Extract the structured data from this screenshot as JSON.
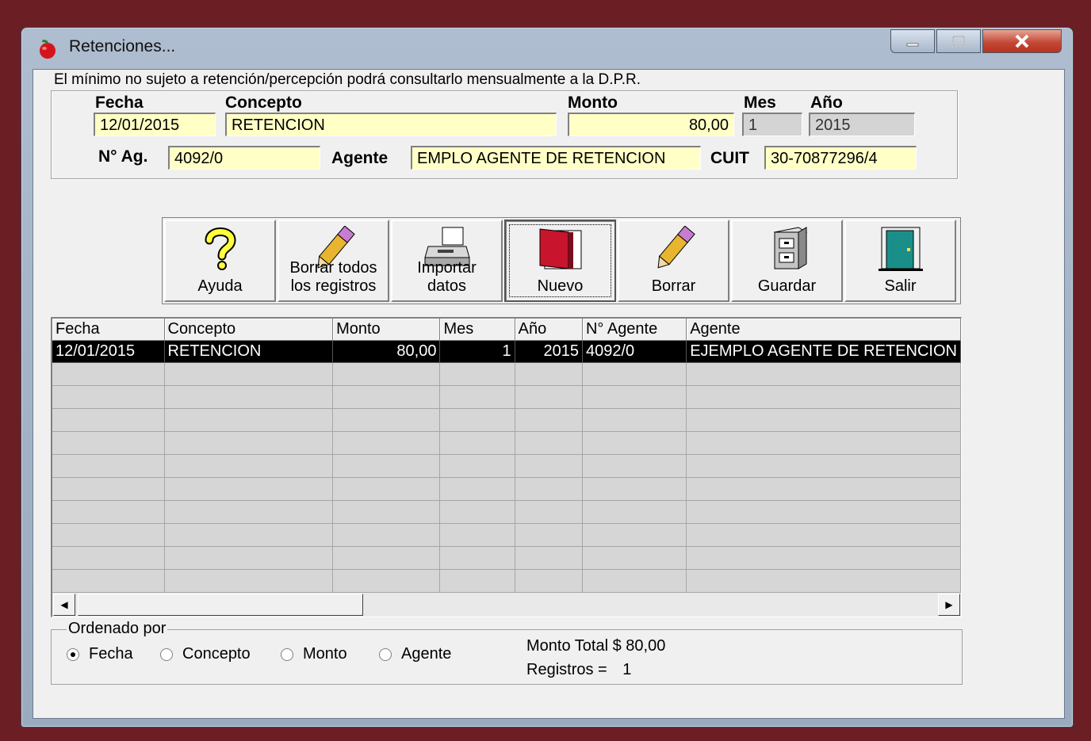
{
  "window": {
    "title": "Retenciones..."
  },
  "info_text": "El mínimo no sujeto a retención/percepción podrá consultarlo mensualmente a la D.P.R.",
  "form": {
    "fecha_label": "Fecha",
    "fecha_value": "12/01/2015",
    "concepto_label": "Concepto",
    "concepto_value": "RETENCION",
    "monto_label": "Monto",
    "monto_value": "80,00",
    "mes_label": "Mes",
    "mes_value": "1",
    "anio_label": "Año",
    "anio_value": "2015",
    "nag_label": "N° Ag.",
    "nag_value": "4092/0",
    "agente_label": "Agente",
    "agente_value": "EMPLO AGENTE DE RETENCION",
    "cuit_label": "CUIT",
    "cuit_value": "30-70877296/4"
  },
  "toolbar": [
    {
      "name": "help-button",
      "icon": "question-mark-icon",
      "line1": "",
      "line2": "Ayuda"
    },
    {
      "name": "delete-all-button",
      "icon": "pencil-eraser-icon",
      "line1": "Borrar todos",
      "line2": "los registros"
    },
    {
      "name": "import-button",
      "icon": "printer-import-icon",
      "line1": "Importar",
      "line2": "datos"
    },
    {
      "name": "new-button",
      "icon": "red-book-icon",
      "line1": "",
      "line2": "Nuevo"
    },
    {
      "name": "delete-button",
      "icon": "pencil-eraser-icon",
      "line1": "",
      "line2": "Borrar"
    },
    {
      "name": "save-button",
      "icon": "file-cabinet-icon",
      "line1": "",
      "line2": "Guardar"
    },
    {
      "name": "exit-button",
      "icon": "exit-door-icon",
      "line1": "",
      "line2": "Salir"
    }
  ],
  "grid": {
    "columns": [
      "Fecha",
      "Concepto",
      "Monto",
      "Mes",
      "Año",
      "N° Agente",
      "Agente"
    ],
    "rows": [
      [
        "12/01/2015",
        "RETENCION",
        "80,00",
        "1",
        "2015",
        "4092/0",
        "EJEMPLO AGENTE DE RETENCION"
      ]
    ]
  },
  "order": {
    "title": "Ordenado por",
    "options": [
      "Fecha",
      "Concepto",
      "Monto",
      "Agente"
    ],
    "selected": "Fecha"
  },
  "totals": {
    "monto_label": "Monto Total $",
    "monto_value": "80,00",
    "registros_label": "Registros =",
    "registros_value": "1"
  },
  "colors": {
    "field_yellow": "#ffffc6",
    "selection": "#000000",
    "close_red": "#c34a36"
  }
}
